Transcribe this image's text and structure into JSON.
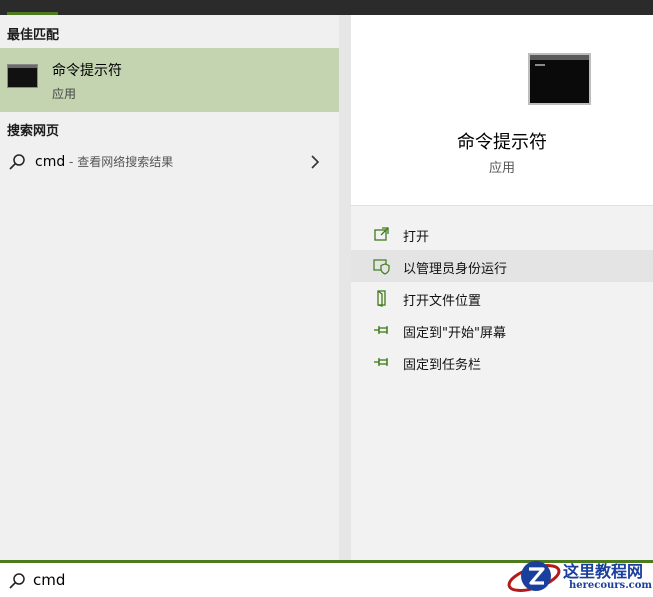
{
  "left_panel": {
    "best_match": {
      "section_title": "最佳匹配",
      "title": "命令提示符",
      "subtitle": "应用",
      "icon": "cmd-icon"
    },
    "web_search": {
      "section_title": "搜索网页",
      "query": "cmd",
      "hint": " - 查看网络搜索结果",
      "icon": "search-icon",
      "chevron": "chevron-right-icon"
    }
  },
  "right_panel": {
    "app_title": "命令提示符",
    "app_subtitle": "应用",
    "actions": [
      {
        "label": "打开",
        "icon": "open-icon",
        "highlighted": false
      },
      {
        "label": "以管理员身份运行",
        "icon": "shield-icon",
        "highlighted": true
      },
      {
        "label": "打开文件位置",
        "icon": "file-location-icon",
        "highlighted": false
      },
      {
        "label": "固定到\"开始\"屏幕",
        "icon": "pin-icon",
        "highlighted": false
      },
      {
        "label": "固定到任务栏",
        "icon": "pin-icon",
        "highlighted": false
      }
    ]
  },
  "search_bar": {
    "value": "cmd",
    "icon": "search-icon"
  },
  "watermark": {
    "title": "这里教程网",
    "url": "herecours.com"
  },
  "colors": {
    "accent": "#4c7a1e",
    "selected_bg": "#c4d4b0",
    "hover_bg": "#e4e4e4",
    "watermark_blue": "#1a3f9c"
  }
}
